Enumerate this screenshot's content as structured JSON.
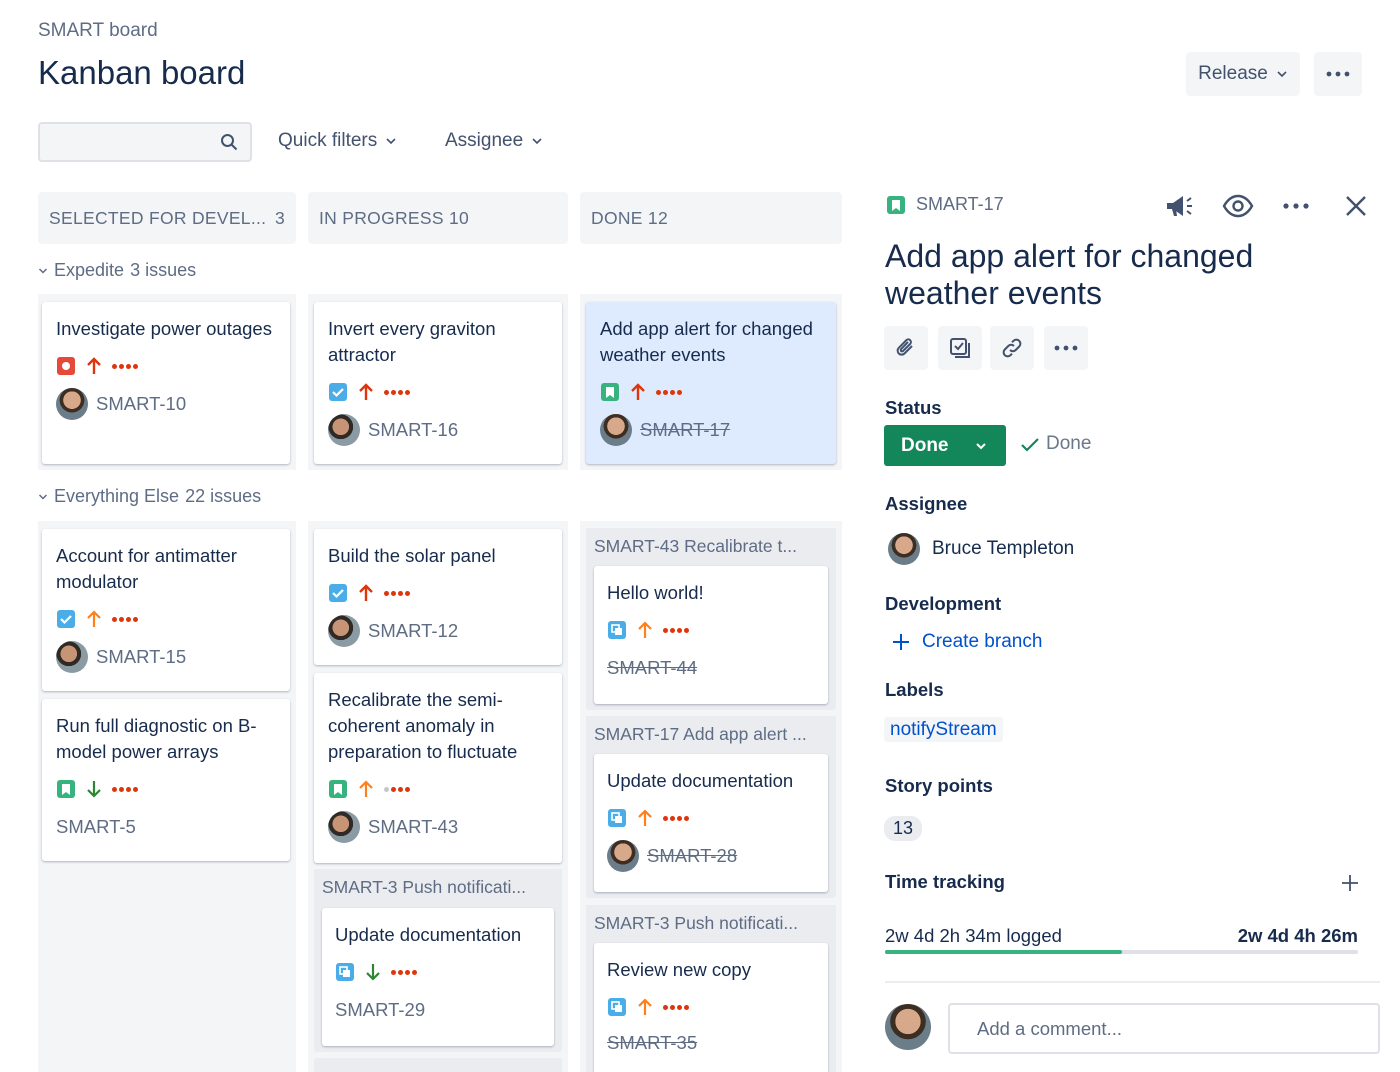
{
  "header": {
    "breadcrumb": "SMART board",
    "title": "Kanban board",
    "release_label": "Release"
  },
  "filters": {
    "search_placeholder": "",
    "quick_filters": "Quick filters",
    "assignee": "Assignee"
  },
  "columns": [
    {
      "name": "SELECTED FOR DEVEL...",
      "count": "3"
    },
    {
      "name": "IN PROGRESS 10",
      "count": ""
    },
    {
      "name": "DONE 12",
      "count": ""
    }
  ],
  "swimlanes": {
    "expedite": "Expedite",
    "expedite_count": "3 issues",
    "everything_else": "Everything Else",
    "everything_else_count": "22 issues"
  },
  "cards": {
    "c10": {
      "title": "Investigate power outages",
      "key": "SMART-10"
    },
    "c16": {
      "title": "Invert every graviton attractor",
      "key": "SMART-16"
    },
    "c17": {
      "title": "Add app alert for changed weather events",
      "key": "SMART-17"
    },
    "c15": {
      "title": "Account for antimatter modulator",
      "key": "SMART-15"
    },
    "c5": {
      "title": "Run full diagnostic on B-model power arrays",
      "key": "SMART-5"
    },
    "c12": {
      "title": "Build the solar panel",
      "key": "SMART-12"
    },
    "c43": {
      "title": "Recalibrate the semi-coherent anomaly in preparation to fluctuate",
      "key": "SMART-43"
    },
    "g3a": {
      "head": "SMART-3 Push notificati...",
      "title": "Update documentation",
      "key": "SMART-29"
    },
    "g43": {
      "head": "SMART-43 Recalibrate t...",
      "title": "Hello world!",
      "key": "SMART-44"
    },
    "g17": {
      "head": "SMART-17 Add app alert ...",
      "title": "Update documentation",
      "key": "SMART-28"
    },
    "g3b": {
      "head": "SMART-3 Push notificati...",
      "title": "Review new copy",
      "key": "SMART-35"
    }
  },
  "panel": {
    "key": "SMART-17",
    "title": "Add app alert for changed weather events",
    "status_label": "Status",
    "status_value": "Done",
    "resolution": "Done",
    "assignee_label": "Assignee",
    "assignee_name": "Bruce Templeton",
    "development_label": "Development",
    "create_branch": "Create branch",
    "labels_label": "Labels",
    "label_value": "notifyStream",
    "story_points_label": "Story points",
    "story_points": "13",
    "time_tracking_label": "Time tracking",
    "time_logged": "2w 4d 2h 34m logged",
    "time_remaining": "2w 4d 4h 26m",
    "time_progress": 0.5,
    "comment_placeholder": "Add a comment..."
  },
  "colors": {
    "accent": "#0052cc",
    "done_green": "#14875a",
    "priority_red": "#de350b",
    "priority_orange": "#ff7f1a",
    "story_green": "#36b37e",
    "task_blue": "#4c9aff",
    "bug_red": "#e5493a"
  }
}
